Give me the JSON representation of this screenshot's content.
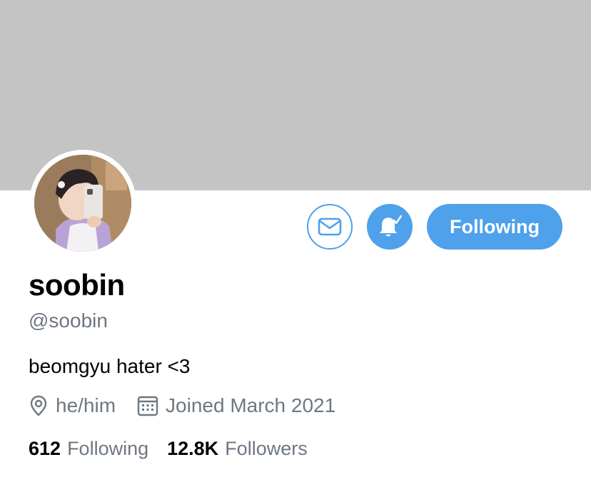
{
  "profile": {
    "display_name": "soobin",
    "handle": "@soobin",
    "bio": "beomgyu hater <3",
    "location": "he/him",
    "joined": "Joined March 2021"
  },
  "actions": {
    "follow_label": "Following",
    "message_icon": "envelope-icon",
    "notify_icon": "bell-check-icon"
  },
  "stats": {
    "following_count": "612",
    "following_label": "Following",
    "followers_count": "12.8K",
    "followers_label": "Followers"
  },
  "colors": {
    "accent": "#4ea1ea",
    "banner": "#c4c4c4",
    "muted_text": "#6e7781"
  }
}
